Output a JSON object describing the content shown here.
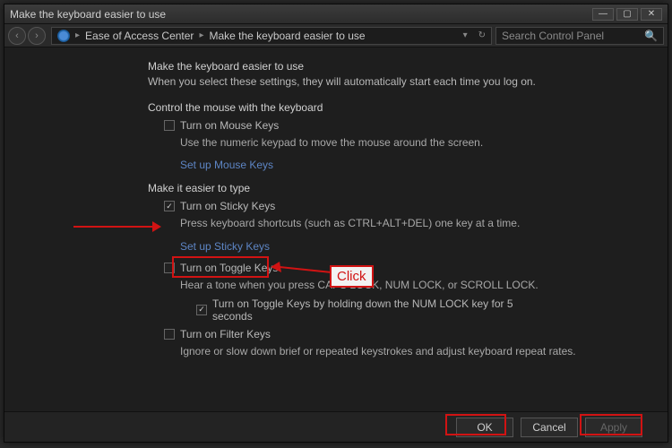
{
  "window_title": "Make the keyboard easier to use",
  "breadcrumb": {
    "item1": "Ease of Access Center",
    "item2": "Make the keyboard easier to use"
  },
  "search_placeholder": "Search Control Panel",
  "heading": "Make the keyboard easier to use",
  "intro": "When you select these settings, they will automatically start each time you log on.",
  "section_mouse": {
    "title": "Control the mouse with the keyboard",
    "opt_label": "Turn on Mouse Keys",
    "opt_desc": "Use the numeric keypad to move the mouse around the screen.",
    "link": "Set up Mouse Keys"
  },
  "section_type": {
    "title": "Make it easier to type",
    "sticky_label": "Turn on Sticky Keys",
    "sticky_desc": "Press keyboard shortcuts (such as CTRL+ALT+DEL) one key at a time.",
    "sticky_link": "Set up Sticky Keys",
    "toggle_label": "Turn on Toggle Keys",
    "toggle_desc": "Hear a tone when you press CAPS LOCK, NUM LOCK, or SCROLL LOCK.",
    "toggle_sub_label": "Turn on Toggle Keys by holding down the NUM LOCK key for 5 seconds",
    "filter_label": "Turn on Filter Keys",
    "filter_desc": "Ignore or slow down brief or repeated keystrokes and adjust keyboard repeat rates."
  },
  "footer": {
    "ok": "OK",
    "cancel": "Cancel",
    "apply": "Apply"
  },
  "annotations": {
    "click_label": "Click",
    "highlight_color": "#d11313"
  }
}
